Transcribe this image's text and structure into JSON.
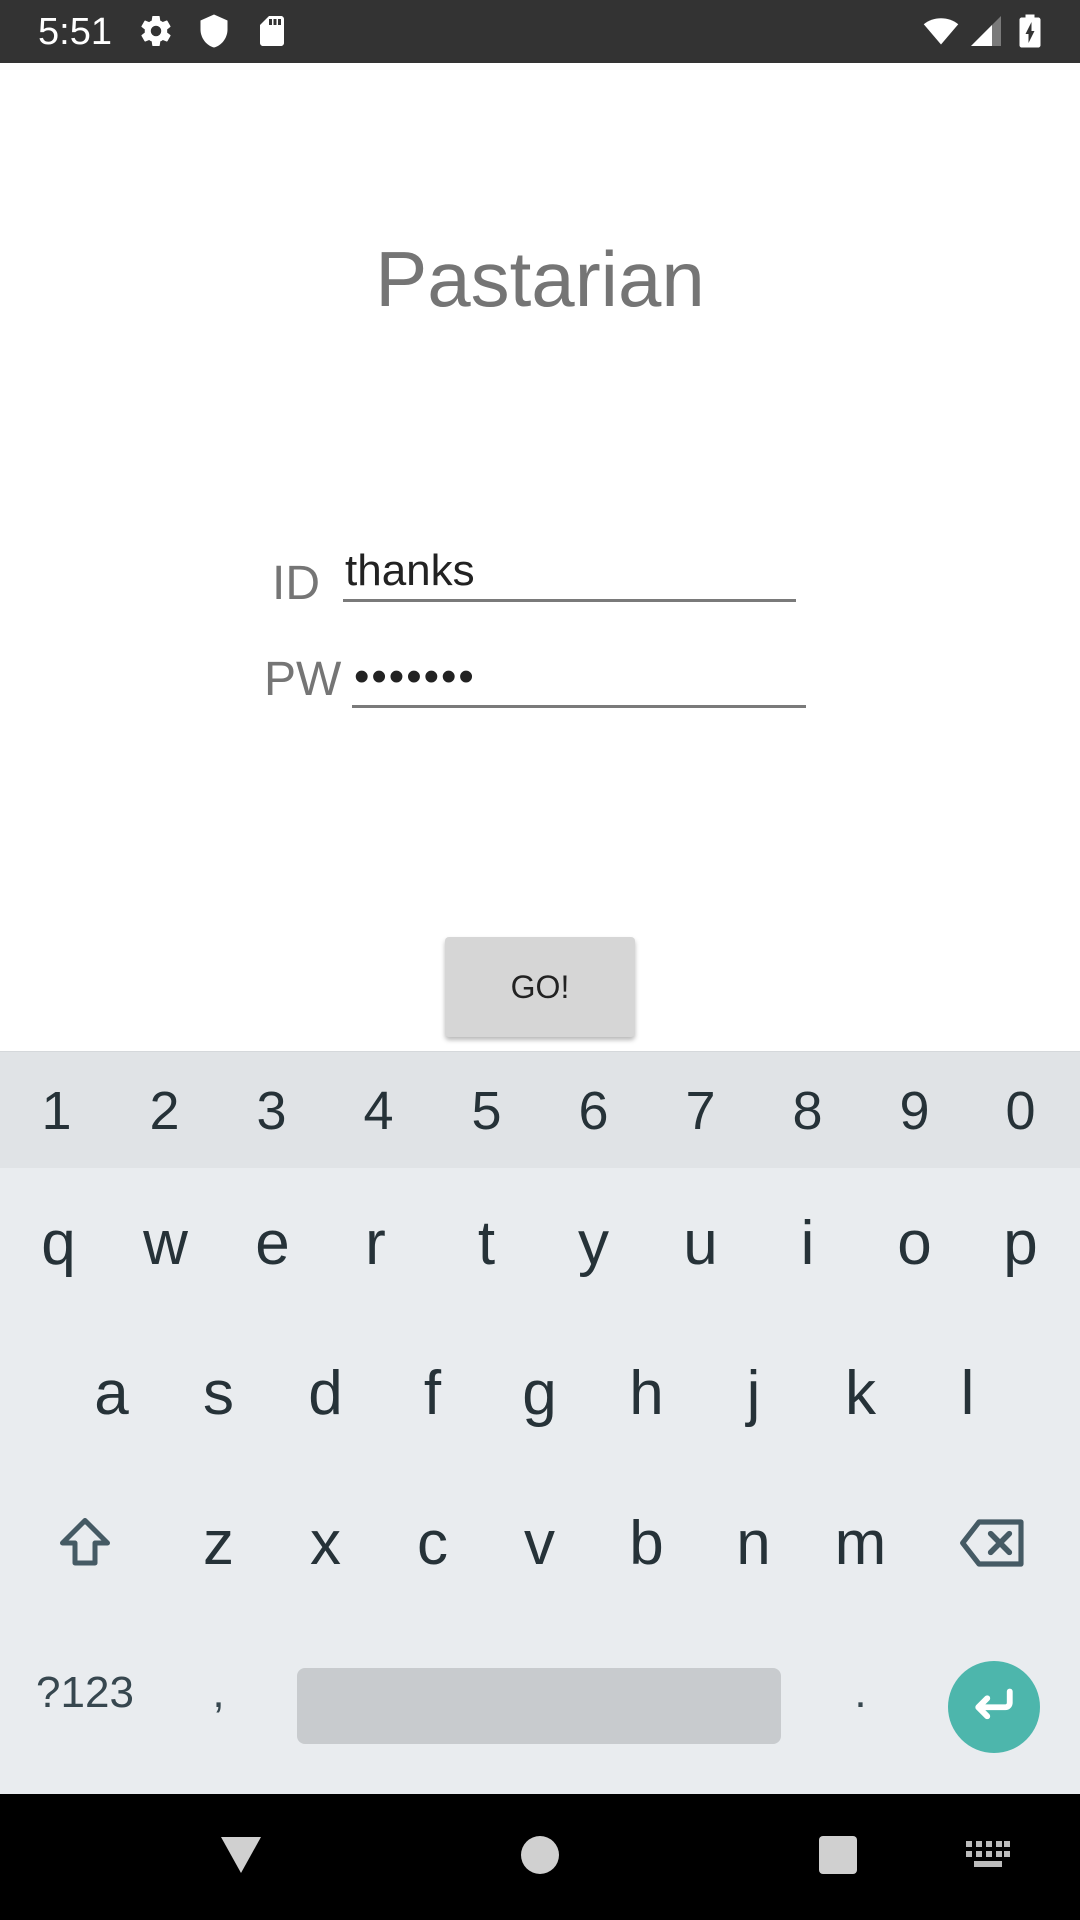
{
  "status_bar": {
    "time": "5:51",
    "left_icons": [
      "gear-icon",
      "shield-icon",
      "sd-card-icon"
    ],
    "right_icons": [
      "wifi-icon",
      "signal-icon",
      "battery-charging-icon"
    ],
    "background": "#333333"
  },
  "app": {
    "title": "Pastarian",
    "id_label": "ID",
    "id_value": "thanks",
    "pw_label": "PW",
    "pw_value": "•••••••",
    "go_label": "GO!"
  },
  "keyboard": {
    "number_row": [
      "1",
      "2",
      "3",
      "4",
      "5",
      "6",
      "7",
      "8",
      "9",
      "0"
    ],
    "row_1": [
      "q",
      "w",
      "e",
      "r",
      "t",
      "y",
      "u",
      "i",
      "o",
      "p"
    ],
    "row_2": [
      "a",
      "s",
      "d",
      "f",
      "g",
      "h",
      "j",
      "k",
      "l"
    ],
    "row_3": [
      "z",
      "x",
      "c",
      "v",
      "b",
      "n",
      "m"
    ],
    "symbols_label": "?123",
    "comma_label": ",",
    "period_label": ".",
    "icons": [
      "shift-icon",
      "backspace-icon",
      "enter-icon"
    ],
    "accent_color": "#4db6ac"
  },
  "nav_bar": {
    "icons": [
      "back-triangle-icon",
      "home-circle-icon",
      "recents-square-icon",
      "keyboard-switch-icon"
    ]
  }
}
